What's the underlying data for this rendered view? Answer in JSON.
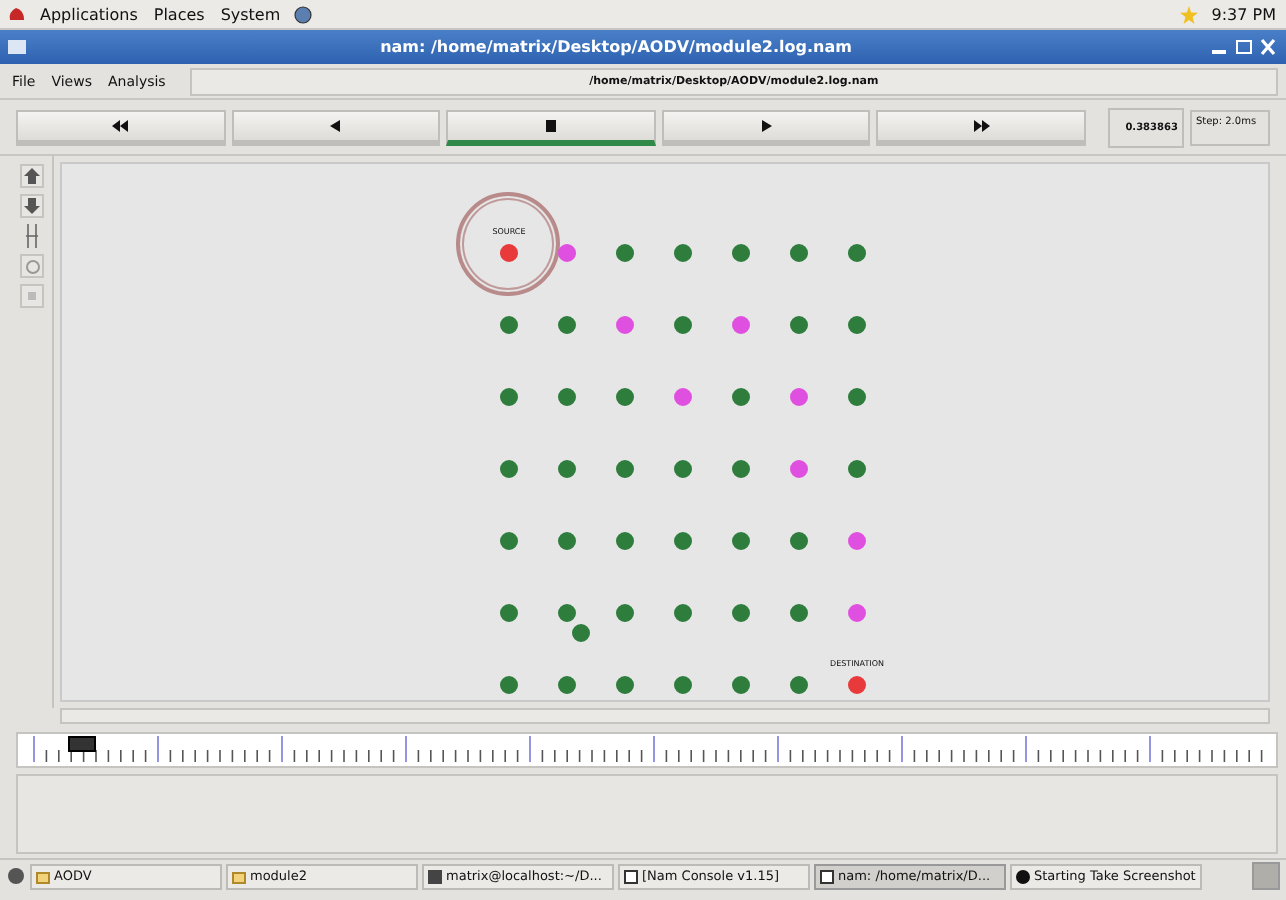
{
  "top_panel": {
    "menus": [
      "Applications",
      "Places",
      "System"
    ],
    "clock": "9:37 PM"
  },
  "window": {
    "title": "nam: /home/matrix/Desktop/AODV/module2.log.nam"
  },
  "menu_bar": {
    "items": [
      "File",
      "Views",
      "Analysis"
    ],
    "file_path": "/home/matrix/Desktop/AODV/module2.log.nam"
  },
  "playback": {
    "buttons": [
      {
        "kind": "rewind",
        "selected": false
      },
      {
        "kind": "back",
        "selected": false
      },
      {
        "kind": "stop",
        "selected": true
      },
      {
        "kind": "play",
        "selected": false
      },
      {
        "kind": "forward",
        "selected": false
      }
    ],
    "time": "0.383863",
    "step": "Step: 2.0ms"
  },
  "network": {
    "rows": [
      [
        {
          "color": "#e83a3a",
          "label": "SOURCE",
          "range": true
        },
        {
          "color": "#e050e0"
        },
        {
          "color": "#2e7d3c"
        },
        {
          "color": "#2e7d3c"
        },
        {
          "color": "#2e7d3c"
        },
        {
          "color": "#2e7d3c"
        },
        {
          "color": "#2e7d3c"
        }
      ],
      [
        {
          "color": "#2e7d3c"
        },
        {
          "color": "#2e7d3c"
        },
        {
          "color": "#e050e0"
        },
        {
          "color": "#2e7d3c"
        },
        {
          "color": "#e050e0"
        },
        {
          "color": "#2e7d3c"
        },
        {
          "color": "#2e7d3c"
        }
      ],
      [
        {
          "color": "#2e7d3c"
        },
        {
          "color": "#2e7d3c"
        },
        {
          "color": "#2e7d3c"
        },
        {
          "color": "#e050e0"
        },
        {
          "color": "#2e7d3c"
        },
        {
          "color": "#e050e0"
        },
        {
          "color": "#2e7d3c"
        }
      ],
      [
        {
          "color": "#2e7d3c"
        },
        {
          "color": "#2e7d3c"
        },
        {
          "color": "#2e7d3c"
        },
        {
          "color": "#2e7d3c"
        },
        {
          "color": "#2e7d3c"
        },
        {
          "color": "#e050e0"
        },
        {
          "color": "#2e7d3c"
        }
      ],
      [
        {
          "color": "#2e7d3c"
        },
        {
          "color": "#2e7d3c"
        },
        {
          "color": "#2e7d3c"
        },
        {
          "color": "#2e7d3c"
        },
        {
          "color": "#2e7d3c"
        },
        {
          "color": "#2e7d3c"
        },
        {
          "color": "#e050e0"
        }
      ],
      [
        {
          "color": "#2e7d3c"
        },
        {
          "color": "#2e7d3c"
        },
        {
          "color": "#2e7d3c"
        },
        {
          "color": "#2e7d3c"
        },
        {
          "color": "#2e7d3c"
        },
        {
          "color": "#2e7d3c"
        },
        {
          "color": "#e050e0"
        }
      ],
      [
        {
          "color": "#2e7d3c"
        },
        {
          "color": "#2e7d3c"
        },
        {
          "color": "#2e7d3c"
        },
        {
          "color": "#2e7d3c"
        },
        {
          "color": "#2e7d3c"
        },
        {
          "color": "#2e7d3c"
        },
        {
          "color": "#e83a3a",
          "label": "DESTINATION"
        }
      ]
    ],
    "stray_nodes": [
      {
        "color": "#2e7d3c"
      }
    ]
  },
  "timeline": {
    "level": 0.04
  },
  "taskbar": {
    "items": [
      {
        "label": "AODV",
        "kind": "folder",
        "selected": false
      },
      {
        "label": "module2",
        "kind": "folder",
        "selected": false
      },
      {
        "label": "matrix@localhost:~/D...",
        "kind": "terminal",
        "selected": false
      },
      {
        "label": "[Nam Console v1.15]",
        "kind": "window",
        "selected": false
      },
      {
        "label": "nam: /home/matrix/D...",
        "kind": "window",
        "selected": true
      },
      {
        "label": "Starting Take Screenshot",
        "kind": "camera",
        "selected": false
      }
    ]
  }
}
